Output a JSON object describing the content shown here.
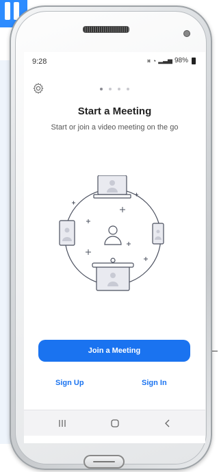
{
  "status": {
    "time": "9:28",
    "battery": "98%"
  },
  "onboarding": {
    "title": "Start a Meeting",
    "subtitle": "Start or join a video meeting on the go",
    "page_count": 4,
    "active_page": 1
  },
  "actions": {
    "join_label": "Join a Meeting",
    "signup_label": "Sign Up",
    "signin_label": "Sign In"
  },
  "colors": {
    "accent": "#1a73f0",
    "brand": "#2d8cff"
  },
  "icons": {
    "settings": "gear-icon",
    "recents": "recent-apps-icon",
    "home": "home-icon",
    "back": "back-icon"
  }
}
